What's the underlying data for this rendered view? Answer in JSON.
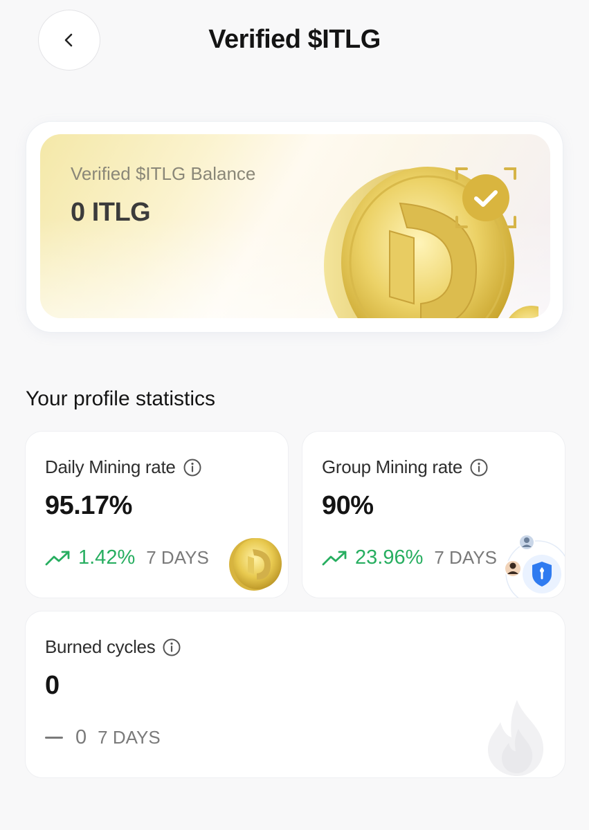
{
  "header": {
    "back_icon": "chevron-left-icon",
    "title": "Verified $ITLG"
  },
  "balance": {
    "label": "Verified $ITLG Balance",
    "value": "0 ITLG",
    "badge_icon": "verified-check-icon"
  },
  "stats": {
    "section_title": "Your profile statistics",
    "daily": {
      "label": "Daily Mining rate",
      "value": "95.17%",
      "trend_value": "1.42%",
      "trend_period": "7 DAYS",
      "trend_icon": "trend-up-icon"
    },
    "group": {
      "label": "Group Mining rate",
      "value": "90%",
      "trend_value": "23.96%",
      "trend_period": "7 DAYS",
      "trend_icon": "trend-up-icon"
    },
    "burned": {
      "label": "Burned cycles",
      "value": "0",
      "trend_value": "0",
      "trend_period": "7 DAYS",
      "trend_icon": "dash-icon"
    }
  },
  "colors": {
    "positive": "#27ae60",
    "gold": "#e6c64a",
    "muted": "#7a7a7a",
    "shield_blue": "#2f7bf0"
  }
}
